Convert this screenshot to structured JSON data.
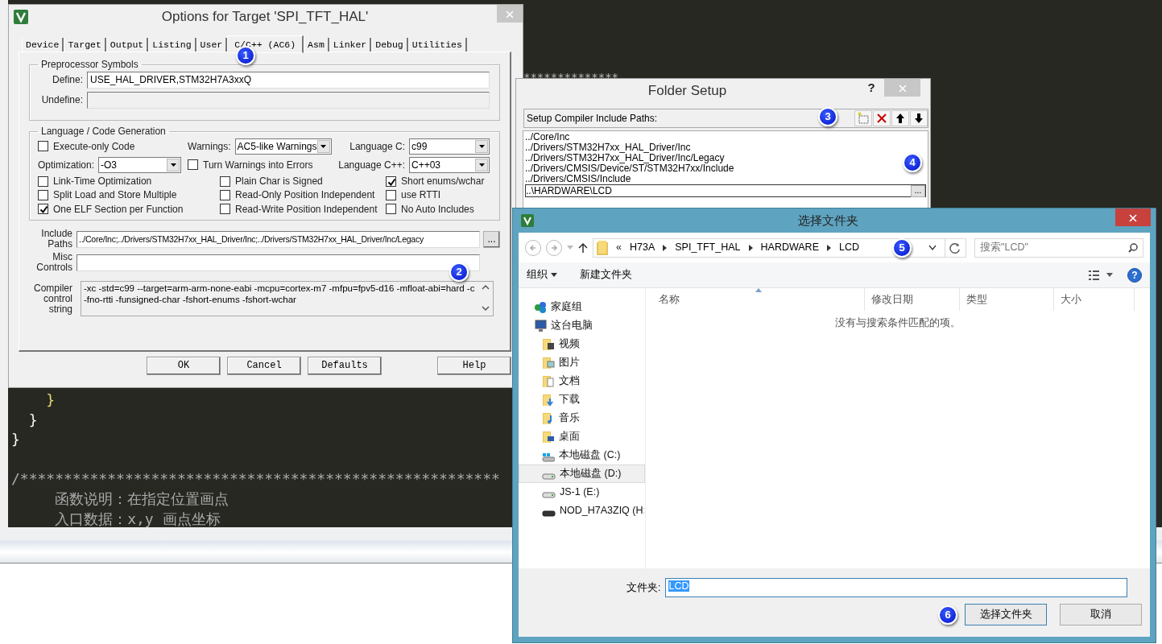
{
  "editor": {
    "top_lines": [
      {
        "text": "**************",
        "kind": "comment-rule"
      }
    ],
    "lines": [
      {
        "text": "    }",
        "kind": "brace-highlight"
      },
      {
        "text": "  }",
        "kind": "brace"
      },
      {
        "text": "}",
        "kind": "brace"
      },
      {
        "text": "/*******************************************************",
        "kind": "comment-rule"
      },
      {
        "text": "     函数说明：在指定位置画点",
        "kind": "comment"
      },
      {
        "text": "     入口数据：x,y 画点坐标",
        "kind": "comment"
      }
    ]
  },
  "options_dialog": {
    "title": "Options for Target 'SPI_TFT_HAL'",
    "tabs": [
      {
        "label": "Device",
        "selected": false
      },
      {
        "label": "Target",
        "selected": false
      },
      {
        "label": "Output",
        "selected": false
      },
      {
        "label": "Listing",
        "selected": false
      },
      {
        "label": "User",
        "selected": false
      },
      {
        "label": "C/C++ (AC6)",
        "selected": true
      },
      {
        "label": "Asm",
        "selected": false
      },
      {
        "label": "Linker",
        "selected": false
      },
      {
        "label": "Debug",
        "selected": false
      },
      {
        "label": "Utilities",
        "selected": false
      }
    ],
    "preprocessor": {
      "title": "Preprocessor Symbols",
      "define_label": "Define:",
      "define_value": "USE_HAL_DRIVER,STM32H7A3xxQ",
      "undefine_label": "Undefine:"
    },
    "language": {
      "title": "Language / Code Generation",
      "controls": [
        {
          "kind": "checkbox",
          "label": "Execute-only Code",
          "checked": false
        },
        {
          "kind": "select",
          "label": "Warnings:",
          "value": "AC5-like Warnings"
        },
        {
          "kind": "select",
          "label": "Language C:",
          "value": "c99"
        },
        {
          "kind": "select",
          "label": "Optimization:",
          "value": "-O3"
        },
        {
          "kind": "checkbox",
          "label": "Turn Warnings into Errors",
          "checked": false
        },
        {
          "kind": "select",
          "label": "Language C++:",
          "value": "C++03"
        },
        {
          "kind": "checkbox",
          "label": "Link-Time Optimization",
          "checked": false
        },
        {
          "kind": "checkbox",
          "label": "Plain Char is Signed",
          "checked": false
        },
        {
          "kind": "checkbox",
          "label": "Short enums/wchar",
          "checked": true
        },
        {
          "kind": "checkbox",
          "label": "Split Load and Store Multiple",
          "checked": false
        },
        {
          "kind": "checkbox",
          "label": "Read-Only Position Independent",
          "checked": false
        },
        {
          "kind": "checkbox",
          "label": "use RTTI",
          "checked": false
        },
        {
          "kind": "checkbox",
          "label": "One ELF Section per Function",
          "checked": true
        },
        {
          "kind": "checkbox",
          "label": "Read-Write Position Independent",
          "checked": false
        },
        {
          "kind": "checkbox",
          "label": "No Auto Includes",
          "checked": false
        }
      ]
    },
    "include_paths": {
      "label": "Include Paths",
      "value": "../Core/Inc;../Drivers/STM32H7xx_HAL_Driver/Inc;../Drivers/STM32H7xx_HAL_Driver/Inc/Legacy",
      "browse": "..."
    },
    "misc_controls": {
      "label": "Misc Controls"
    },
    "compiler_string": {
      "label": "Compiler control string",
      "value": "-xc -std=c99 --target=arm-arm-none-eabi -mcpu=cortex-m7 -mfpu=fpv5-d16 -mfloat-abi=hard -c\n-fno-rtti -funsigned-char -fshort-enums -fshort-wchar"
    },
    "buttons": [
      "OK",
      "Cancel",
      "Defaults",
      "Help"
    ]
  },
  "folder_setup": {
    "title": "Folder Setup",
    "help": "?",
    "header": "Setup Compiler Include Paths:",
    "paths": [
      "../Core/Inc",
      "../Drivers/STM32H7xx_HAL_Driver/Inc",
      "../Drivers/STM32H7xx_HAL_Driver/Inc/Legacy",
      "../Drivers/CMSIS/Device/ST/STM32H7xx/Include",
      "../Drivers/CMSIS/Include"
    ],
    "edit_value": "..\\HARDWARE\\LCD",
    "browse": "..."
  },
  "browse_dialog": {
    "title": "选择文件夹",
    "overflow": "«",
    "breadcrumb": [
      "H73A",
      "SPI_TFT_HAL",
      "HARDWARE",
      "LCD"
    ],
    "search_placeholder": "搜索\"LCD\"",
    "organize": "组织",
    "new_folder": "新建文件夹",
    "help": "?",
    "nav": [
      {
        "label": "家庭组",
        "kind": "homegroup",
        "selected": false
      },
      {
        "label": "这台电脑",
        "kind": "computer",
        "selected": false,
        "children": [
          {
            "label": "视频",
            "kind": "folder-video",
            "selected": false
          },
          {
            "label": "图片",
            "kind": "folder-pictures",
            "selected": false
          },
          {
            "label": "文档",
            "kind": "folder-documents",
            "selected": false
          },
          {
            "label": "下载",
            "kind": "folder-downloads",
            "selected": false
          },
          {
            "label": "音乐",
            "kind": "folder-music",
            "selected": false
          },
          {
            "label": "桌面",
            "kind": "folder-desktop",
            "selected": false
          },
          {
            "label": "本地磁盘 (C:)",
            "kind": "drive-system",
            "selected": false
          },
          {
            "label": "本地磁盘 (D:)",
            "kind": "drive",
            "selected": true
          },
          {
            "label": "JS-1 (E:)",
            "kind": "drive",
            "selected": false
          },
          {
            "label": "NOD_H7A3ZIQ (H:",
            "kind": "drive-removable",
            "selected": false
          }
        ]
      }
    ],
    "columns": [
      {
        "label": "名称",
        "sorted": true
      },
      {
        "label": "修改日期",
        "sorted": false
      },
      {
        "label": "类型",
        "sorted": false
      },
      {
        "label": "大小",
        "sorted": false
      }
    ],
    "empty_message": "没有与搜索条件匹配的项。",
    "folder_label": "文件夹:",
    "folder_value": "LCD",
    "buttons": [
      "选择文件夹",
      "取消"
    ]
  },
  "markers": [
    "1",
    "2",
    "3",
    "4",
    "5",
    "6"
  ]
}
